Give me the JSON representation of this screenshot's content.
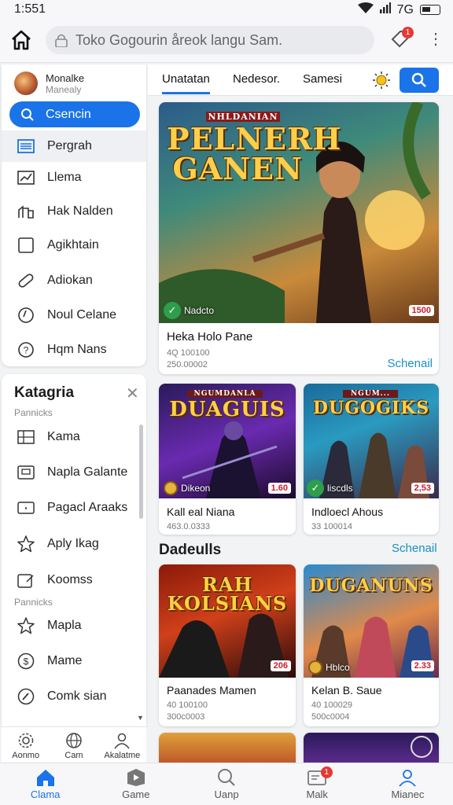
{
  "status": {
    "time": "1:551",
    "network": "7G"
  },
  "browser": {
    "search_placeholder": "Toko Gogourin åreok langu Sam.",
    "ext_badge": "1"
  },
  "sidebar": {
    "user_name": "Monalke",
    "user_sub": "Manealy",
    "search_label": "Csencin",
    "items": [
      {
        "label": "Pergrah",
        "icon": "list-icon"
      },
      {
        "label": "Llema",
        "icon": "chart-icon"
      },
      {
        "label": "Hak Nalden",
        "icon": "building-icon"
      },
      {
        "label": "Agikhtain",
        "icon": "square-icon"
      },
      {
        "label": "Adiokan",
        "icon": "pill-icon"
      },
      {
        "label": "Noul Celane",
        "icon": "clock-icon"
      },
      {
        "label": "Hqm Nans",
        "icon": "help-icon"
      }
    ]
  },
  "categories": {
    "title": "Katagria",
    "section1": "Pannicks",
    "section2": "Pannicks",
    "items": [
      {
        "label": "Kama",
        "icon": "grid-icon"
      },
      {
        "label": "Napla Galante",
        "icon": "card-icon"
      },
      {
        "label": "Pagacl Araaks",
        "icon": "window-icon"
      },
      {
        "label": "Aply Ikag",
        "icon": "star-icon"
      },
      {
        "label": "Koomss",
        "icon": "clipboard-icon"
      },
      {
        "label": "Mapla",
        "icon": "star-icon"
      },
      {
        "label": "Mame",
        "icon": "dollar-icon"
      },
      {
        "label": "Comk sian",
        "icon": "gauge-icon"
      }
    ],
    "mini_nav": [
      "Aonmo",
      "Cam",
      "Akalatme"
    ]
  },
  "tabs": {
    "items": [
      "Unatatan",
      "Nedesor.",
      "Samesi"
    ]
  },
  "cards": {
    "featured": {
      "art_title": "PELNERH GANEN",
      "top_text": "NHLDANIAN",
      "badge": "Nadcto",
      "price": "1500",
      "title": "Heka Holo Pane",
      "line1": "4Q 100100",
      "line2": "250.00002",
      "link": "Schenail"
    },
    "c1": {
      "art_title": "DUAGUIS",
      "top_text": "NGUMDANLA",
      "badge": "Dikeon",
      "price": "1.60",
      "title": "Kall eal Niana",
      "line1": "463.0.0333"
    },
    "c2": {
      "art_title": "DUGOGIKS",
      "top_text": "NGUM...",
      "badge": "liscdls",
      "price": "2,53",
      "title": "Indloecl Ahous",
      "line1": "33 100014",
      "link": "Schenail"
    },
    "section_title": "Dadeulls",
    "c3": {
      "art_title": "RAH KOLSIANS",
      "price": "206",
      "title": "Paanades Mamen",
      "line1": "40 100100",
      "line2": "300c0003"
    },
    "c4": {
      "art_title": "DUGANUNS",
      "badge": "Hblco",
      "price": "2.33",
      "title": "Kelan B. Saue",
      "line1": "40 100029",
      "line2": "500c0004"
    }
  },
  "bottom_nav": [
    {
      "label": "Clama",
      "icon": "home-icon",
      "active": true
    },
    {
      "label": "Game",
      "icon": "play-icon"
    },
    {
      "label": "Uanp",
      "icon": "search-icon"
    },
    {
      "label": "Malk",
      "icon": "mail-icon",
      "badge": "1"
    },
    {
      "label": "Mianec",
      "icon": "person-icon"
    }
  ],
  "colors": {
    "accent": "#1a73e8",
    "price": "#d11a2a",
    "link": "#1a8fc5"
  }
}
